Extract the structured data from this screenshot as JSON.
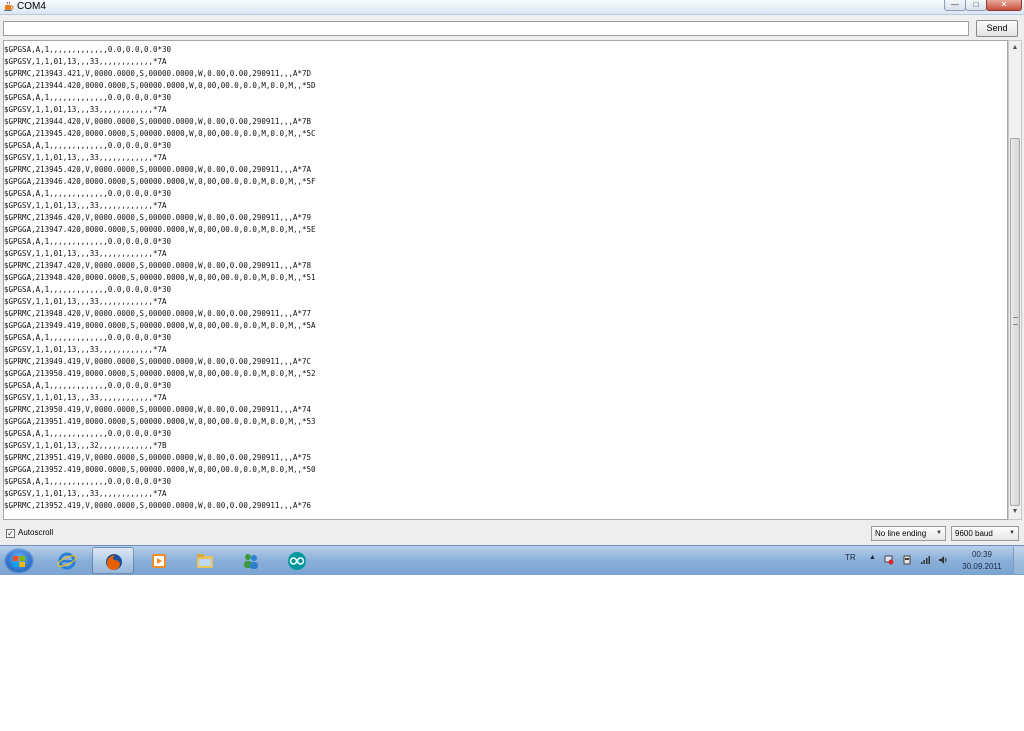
{
  "window": {
    "title": "COM4",
    "controls": {
      "minimize": "—",
      "maximize": "□",
      "close": "✕"
    }
  },
  "send": {
    "input_value": "",
    "button_label": "Send"
  },
  "output_lines": [
    "$GPGSA,A,1,,,,,,,,,,,,,0.0,0.0,0.0*30",
    "$GPGSV,1,1,01,13,,,33,,,,,,,,,,,,*7A",
    "$GPRMC,213943.421,V,0000.0000,S,00000.0000,W,0.00,0.00,290911,,,A*7D",
    "$GPGGA,213944.420,0000.0000,S,00000.0000,W,0,00,00.0,0.0,M,0.0,M,,*5D",
    "$GPGSA,A,1,,,,,,,,,,,,,0.0,0.0,0.0*30",
    "$GPGSV,1,1,01,13,,,33,,,,,,,,,,,,*7A",
    "$GPRMC,213944.420,V,0000.0000,S,00000.0000,W,0.00,0.00,290911,,,A*7B",
    "$GPGGA,213945.420,0000.0000,S,00000.0000,W,0,00,00.0,0.0,M,0.0,M,,*5C",
    "$GPGSA,A,1,,,,,,,,,,,,,0.0,0.0,0.0*30",
    "$GPGSV,1,1,01,13,,,33,,,,,,,,,,,,*7A",
    "$GPRMC,213945.420,V,0000.0000,S,00000.0000,W,0.00,0.00,290911,,,A*7A",
    "$GPGGA,213946.420,0000.0000,S,00000.0000,W,0,00,00.0,0.0,M,0.0,M,,*5F",
    "$GPGSA,A,1,,,,,,,,,,,,,0.0,0.0,0.0*30",
    "$GPGSV,1,1,01,13,,,33,,,,,,,,,,,,*7A",
    "$GPRMC,213946.420,V,0000.0000,S,00000.0000,W,0.00,0.00,290911,,,A*79",
    "$GPGGA,213947.420,0000.0000,S,00000.0000,W,0,00,00.0,0.0,M,0.0,M,,*5E",
    "$GPGSA,A,1,,,,,,,,,,,,,0.0,0.0,0.0*30",
    "$GPGSV,1,1,01,13,,,33,,,,,,,,,,,,*7A",
    "$GPRMC,213947.420,V,0000.0000,S,00000.0000,W,0.00,0.00,290911,,,A*78",
    "$GPGGA,213948.420,0000.0000,S,00000.0000,W,0,00,00.0,0.0,M,0.0,M,,*51",
    "$GPGSA,A,1,,,,,,,,,,,,,0.0,0.0,0.0*30",
    "$GPGSV,1,1,01,13,,,33,,,,,,,,,,,,*7A",
    "$GPRMC,213948.420,V,0000.0000,S,00000.0000,W,0.00,0.00,290911,,,A*77",
    "$GPGGA,213949.419,0000.0000,S,00000.0000,W,0,00,00.0,0.0,M,0.0,M,,*5A",
    "$GPGSA,A,1,,,,,,,,,,,,,0.0,0.0,0.0*30",
    "$GPGSV,1,1,01,13,,,33,,,,,,,,,,,,*7A",
    "$GPRMC,213949.419,V,0000.0000,S,00000.0000,W,0.00,0.00,290911,,,A*7C",
    "$GPGGA,213950.419,0000.0000,S,00000.0000,W,0,00,00.0,0.0,M,0.0,M,,*52",
    "$GPGSA,A,1,,,,,,,,,,,,,0.0,0.0,0.0*30",
    "$GPGSV,1,1,01,13,,,33,,,,,,,,,,,,*7A",
    "$GPRMC,213950.419,V,0000.0000,S,00000.0000,W,0.00,0.00,290911,,,A*74",
    "$GPGGA,213951.419,0000.0000,S,00000.0000,W,0,00,00.0,0.0,M,0.0,M,,*53",
    "$GPGSA,A,1,,,,,,,,,,,,,0.0,0.0,0.0*30",
    "$GPGSV,1,1,01,13,,,32,,,,,,,,,,,,*7B",
    "$GPRMC,213951.419,V,0000.0000,S,00000.0000,W,0.00,0.00,290911,,,A*75",
    "$GPGGA,213952.419,0000.0000,S,00000.0000,W,0,00,00.0,0.0,M,0.0,M,,*50",
    "$GPGSA,A,1,,,,,,,,,,,,,0.0,0.0,0.0*30",
    "$GPGSV,1,1,01,13,,,33,,,,,,,,,,,,*7A",
    "$GPRMC,213952.419,V,0000.0000,S,00000.0000,W,0.00,0.00,290911,,,A*76"
  ],
  "bottom_bar": {
    "autoscroll": {
      "label": "Autoscroll",
      "checked": true,
      "check_glyph": "✓"
    },
    "line_ending": {
      "selected": "No line ending",
      "arrow": "▼"
    },
    "baud_rate": {
      "selected": "9600 baud",
      "arrow": "▼"
    }
  },
  "scrollbar": {
    "up": "▲",
    "down": "▼"
  },
  "taskbar": {
    "apps": [
      {
        "icon": "internet-explorer-icon",
        "active": false
      },
      {
        "icon": "firefox-icon",
        "active": true
      },
      {
        "icon": "media-player-icon",
        "active": false
      },
      {
        "icon": "file-explorer-icon",
        "active": false
      },
      {
        "icon": "messenger-icon",
        "active": false
      },
      {
        "icon": "arduino-icon",
        "active": false
      }
    ],
    "tray": {
      "language": "TR",
      "expand": "▲",
      "time": "00:39",
      "date": "30.09.2011"
    }
  },
  "colors": {
    "taskbar": "#8ab0d9",
    "close_button": "#c7503c",
    "output_text": "#111111"
  }
}
